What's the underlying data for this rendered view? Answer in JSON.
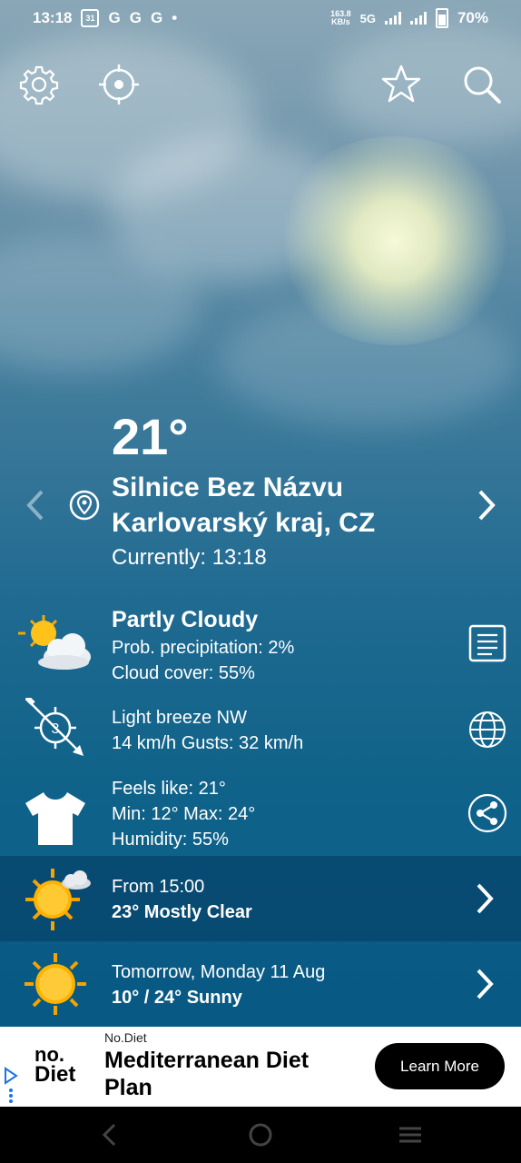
{
  "status_bar": {
    "time": "13:18",
    "calendar_day": "31",
    "notif_letters": [
      "G",
      "G",
      "G"
    ],
    "dot": "•",
    "speed_top": "163.8",
    "speed_bottom": "KB/s",
    "network": "5G",
    "battery": "70%"
  },
  "toolbar": {
    "icons": [
      "gear-icon",
      "locate-icon",
      "star-icon",
      "search-icon"
    ]
  },
  "current": {
    "temperature": "21°",
    "location_line1": "Silnice Bez Názvu",
    "location_line2": "Karlovarský kraj, CZ",
    "currently": "Currently: 13:18"
  },
  "conditions": {
    "title": "Partly Cloudy",
    "precipitation": "Prob. precipitation: 2%",
    "cloud_cover": "Cloud cover: 55%"
  },
  "wind": {
    "beaufort": "3",
    "description": "Light breeze NW",
    "speed": "14 km/h Gusts: 32 km/h"
  },
  "feels": {
    "feels_like": "Feels like: 21°",
    "min_max": "Min: 12° Max: 24°",
    "humidity": "Humidity: 55%"
  },
  "forecast_later": {
    "from": "From 15:00",
    "summary": "23° Mostly Clear"
  },
  "forecast_tomorrow": {
    "date": "Tomorrow, Monday 11 Aug",
    "summary": "10° / 24° Sunny"
  },
  "ad": {
    "brand": "No.Diet",
    "title": "Mediterranean Diet Plan",
    "logo_top": "no.",
    "logo_bottom": "Diet",
    "button": "Learn More"
  }
}
